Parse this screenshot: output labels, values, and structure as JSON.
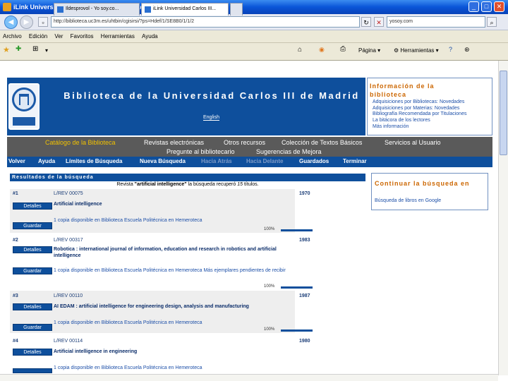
{
  "browser": {
    "title": "iLink Universidad Carlos III de Madrid - Packard Bell",
    "url": "http://biblioteca.uc3m.es/uhtbin/cgisirsi/?ps=Hdef/1/SE8B0/1/1/2",
    "search_value": "yosoy.com",
    "menu": [
      "Archivo",
      "Edición",
      "Ver",
      "Favoritos",
      "Herramientas",
      "Ayuda"
    ],
    "tabs": [
      "Ildesprovol - Yo soy.co...",
      "iLink Universidad Carlos III..."
    ],
    "commands": {
      "page": "Página",
      "tools": "Herramientas"
    }
  },
  "header": {
    "title": "Biblioteca de la Universidad Carlos III de Madrid",
    "english_link": "English"
  },
  "info": {
    "title": "Información de la biblioteca",
    "links": [
      "Adquisiciones por Bibliotecas: Novedades",
      "Adquisiciones por Materias: Novedades",
      "Bibliografía Recomendada por Titulaciones",
      "La bitácora de los lectores",
      "Más información"
    ]
  },
  "nav_primary": {
    "row1": [
      "Catálogo de la Biblioteca",
      "Revistas electrónicas",
      "Otros recursos",
      "Colección de Textos Básicos",
      "Servicios al Usuario"
    ],
    "row2": [
      "Pregunte al bibliotecario",
      "Sugerencias de Mejora"
    ]
  },
  "nav_secondary": [
    {
      "label": "Volver",
      "enabled": true
    },
    {
      "label": "Ayuda",
      "enabled": true
    },
    {
      "label": "Límites de Búsqueda",
      "enabled": true
    },
    {
      "label": "Nueva Búsqueda",
      "enabled": true
    },
    {
      "label": "Hacia Atrás",
      "enabled": false
    },
    {
      "label": "Hacia Delante",
      "enabled": false
    },
    {
      "label": "Guardados",
      "enabled": true
    },
    {
      "label": "Terminar",
      "enabled": true
    }
  ],
  "results": {
    "header": "Resultados de la búsqueda",
    "summary_pre": "Revista",
    "summary_query": "\"artificial intelligence\"",
    "summary_mid": "la búsqueda recuperó",
    "summary_count": "15",
    "summary_post": "títulos.",
    "buttons": {
      "details": "Detalles",
      "save": "Guardar"
    },
    "items": [
      {
        "num": "#1",
        "callno": "L/REV 00075",
        "year": "1970",
        "title": "Artificial intelligence",
        "holdings": "1 copia disponible en Biblioteca Escuela Politécnica en Hemeroteca",
        "pct": "100%"
      },
      {
        "num": "#2",
        "callno": "L/REV 00317",
        "year": "1983",
        "title": "Robotica : international journal of information, education and research in robotics and artificial intelligence",
        "holdings": "1 copia disponible en Biblioteca Escuela Politécnica en Hemeroteca Más ejemplares pendientes de recibir",
        "pct": "100%"
      },
      {
        "num": "#3",
        "callno": "L/REV 00110",
        "year": "1987",
        "title": "AI EDAM : artificial intelligence for engineering design, analysis and manufacturing",
        "holdings": "1 copia disponible en Biblioteca Escuela Politécnica en Hemeroteca",
        "pct": "100%"
      },
      {
        "num": "#4",
        "callno": "L/REV 00114",
        "year": "1980",
        "title": "Artificial intelligence in engineering",
        "holdings": "1 copia disponible en Biblioteca Escuela Politécnica en Hemeroteca",
        "pct": ""
      }
    ]
  },
  "continue": {
    "title": "Continuar la búsqueda en",
    "link": "Búsqueda de libros en Google"
  }
}
